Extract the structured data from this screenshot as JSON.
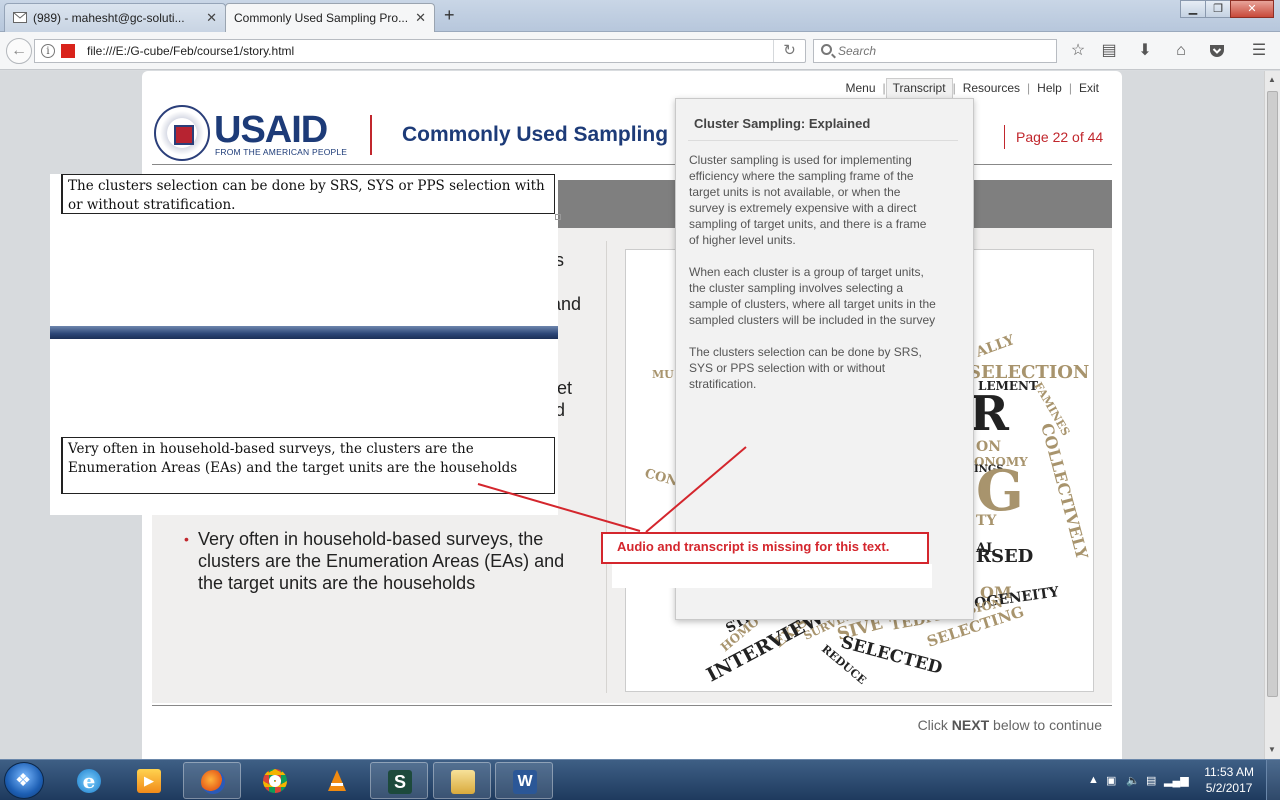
{
  "browser": {
    "tabs": [
      {
        "title": "(989) - mahesht@gc-soluti...",
        "icon": "mail-icon"
      },
      {
        "title": "Commonly Used Sampling Pro...",
        "icon": ""
      }
    ],
    "url": "file:///E:/G-cube/Feb/course1/story.html",
    "search_placeholder": "Search"
  },
  "slide": {
    "menu": [
      "Menu",
      "Transcript",
      "Resources",
      "Help",
      "Exit"
    ],
    "logo": {
      "word": "USAID",
      "tagline": "FROM THE AMERICAN PEOPLE"
    },
    "title": "Commonly Used Sampling",
    "page": "Page 22 of  44",
    "bg_fragments": [
      "s",
      "l",
      "and",
      "get",
      "d"
    ],
    "bullet": "Very often in household-based surveys, the clusters are the Enumeration Areas (EAs) and the target units are the households",
    "continue_prefix": "Click",
    "continue_bold": "NEXT",
    "continue_suffix": "below to continue"
  },
  "transcript": {
    "title": "Cluster Sampling: Explained",
    "paragraphs": [
      "Cluster sampling is used for implementing efficiency where the sampling frame of the target units is not available, or when the survey is extremely expensive with a direct sampling of target units, and there is a frame of higher level units.",
      "When each cluster is a group of target units, the cluster sampling involves selecting a sample of clusters, where all target units in the sampled clusters will be included in the survey",
      "The clusters selection can be done by SRS, SYS or PPS selection with or without stratification."
    ]
  },
  "word_cloud": [
    "ALLY",
    "SELECTION",
    "LEMENT",
    "FAMINES",
    "COLLECTIVELY",
    "R",
    "ON",
    "ONOMY",
    "INGS",
    "G",
    "TY",
    "AL",
    "RSED",
    "MU",
    "CON",
    "OM",
    "OGENEITY",
    "SIVE",
    "TED",
    "PRECISION",
    "SELECTING",
    "STR",
    "HOMO",
    "EXIST",
    "SURVEY",
    "REDUCE",
    "INTERVIEW",
    "SELECTED"
  ],
  "annotations": {
    "crop_row1": "The clusters selection can be done by SRS, SYS or PPS selection with or without stratification.",
    "crop_row2": "Very often in household-based surveys, the clusters are the Enumeration Areas (EAs) and the target units are the households",
    "callout": "Audio and transcript is missing for this text.",
    "color": "#d4262d"
  },
  "taskbar": {
    "apps": [
      "ie-icon",
      "media-player-icon",
      "firefox-icon",
      "chrome-icon",
      "vlc-icon",
      "storyline-icon",
      "file-explorer-icon",
      "word-icon"
    ],
    "time": "11:53 AM",
    "date": "5/2/2017"
  }
}
